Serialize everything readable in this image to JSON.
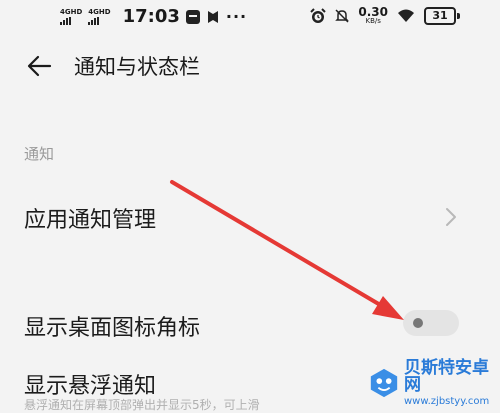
{
  "status_bar": {
    "network1": "4GHD",
    "network2": "4GHD",
    "time": "17:03",
    "dots": "···",
    "speed_value": "0.30",
    "speed_unit": "KB/s",
    "battery": "31"
  },
  "header": {
    "title": "通知与状态栏"
  },
  "section": {
    "title": "通知"
  },
  "rows": {
    "app_notification": {
      "label": "应用通知管理"
    },
    "desktop_badge": {
      "label": "显示桌面图标角标",
      "enabled": false
    },
    "floating_notification": {
      "label": "显示悬浮通知",
      "subtext": "悬浮通知在屏幕顶部弹出并显示5秒，可上滑"
    }
  },
  "watermark": {
    "title": "贝斯特安卓网",
    "url": "www.zjbstyy.com"
  },
  "colors": {
    "background": "#f3f3f3",
    "annotation_arrow": "#e53935",
    "watermark": "#2a7bd8"
  }
}
